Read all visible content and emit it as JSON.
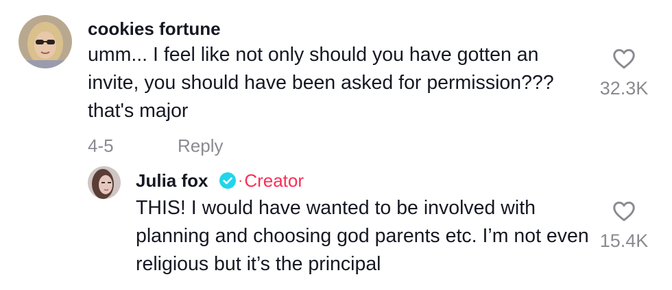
{
  "comments": [
    {
      "username": "cookies fortune",
      "text": "umm... I feel like not only should you have gotten an invite, you should have been asked for permission??? that's major",
      "date": "4-5",
      "reply_label": "Reply",
      "likes": "32.3K",
      "like_icon": "heart-outline-icon"
    }
  ],
  "reply": {
    "username": "Julia fox",
    "verified_icon": "verified-check-icon",
    "separator": "·",
    "creator_label": "Creator",
    "text": "THIS! I would have wanted to be involved with planning and choosing god parents etc. I’m not even religious but it’s the principal",
    "likes": "15.4K",
    "like_icon": "heart-outline-icon"
  },
  "colors": {
    "text": "#161823",
    "secondary": "#8a8b91",
    "creator": "#fe2c55",
    "verified": "#20d5ec"
  }
}
